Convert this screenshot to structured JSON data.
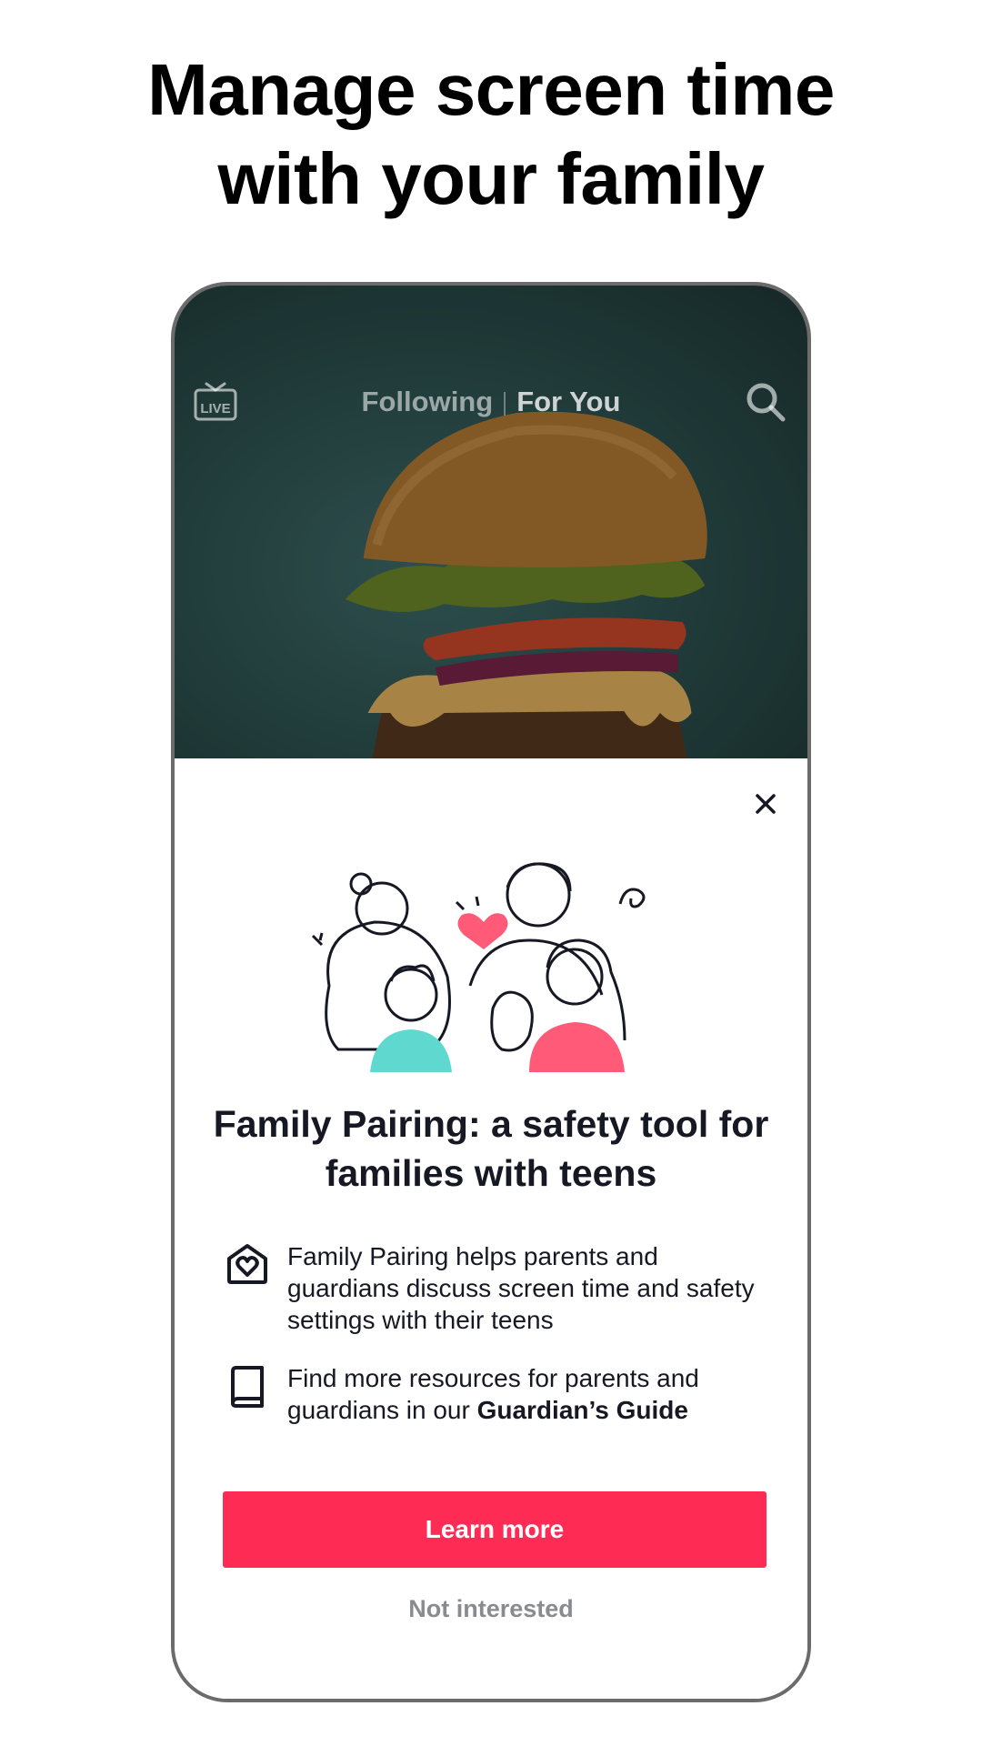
{
  "headline": {
    "line1": "Manage screen time",
    "line2": "with your family"
  },
  "app": {
    "topbar": {
      "live_icon": "live-tv-icon",
      "live_label": "LIVE",
      "tabs": [
        {
          "label": "Following",
          "active": false
        },
        {
          "label": "For You",
          "active": true
        }
      ],
      "search_icon": "search-icon"
    }
  },
  "sheet": {
    "close_icon": "close-icon",
    "title": "Family Pairing: a safety tool for families with teens",
    "items": [
      {
        "icon": "home-heart-icon",
        "text": "Family Pairing helps parents and guardians discuss screen time and safety settings with their teens"
      },
      {
        "icon": "book-icon",
        "text_prefix": "Find more resources for parents and guardians in our ",
        "text_bold": "Guardian’s Guide"
      }
    ],
    "primary_button": "Learn more",
    "secondary_link": "Not interested"
  },
  "colors": {
    "accent": "#fe2c55",
    "teal": "#5fd9cf",
    "pink": "#ff5a78",
    "muted_text": "#8a8b91"
  }
}
